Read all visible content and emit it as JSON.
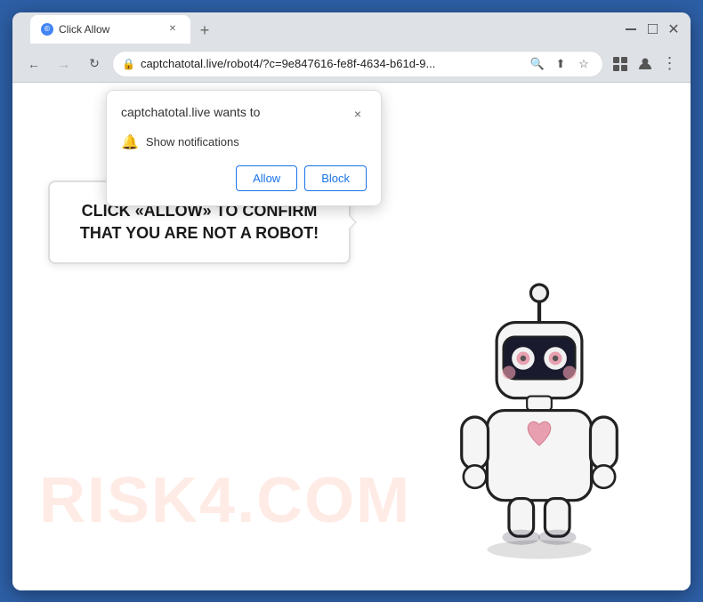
{
  "browser": {
    "tab": {
      "title": "Click Allow",
      "favicon": "©"
    },
    "url": "captchatotal.live/robot4/?c=9e847616-fe8f-4634-b61d-9...",
    "controls": {
      "new_tab": "+",
      "minimize": "—",
      "maximize": "☐",
      "close": "✕"
    }
  },
  "notification_popup": {
    "title": "captchatotal.live wants to",
    "permission": "Show notifications",
    "close_label": "×",
    "allow_label": "Allow",
    "block_label": "Block"
  },
  "page": {
    "bubble_text": "CLICK «ALLOW» TO CONFIRM THAT YOU ARE NOT A ROBOT!",
    "watermark": "RISK4.COM"
  }
}
